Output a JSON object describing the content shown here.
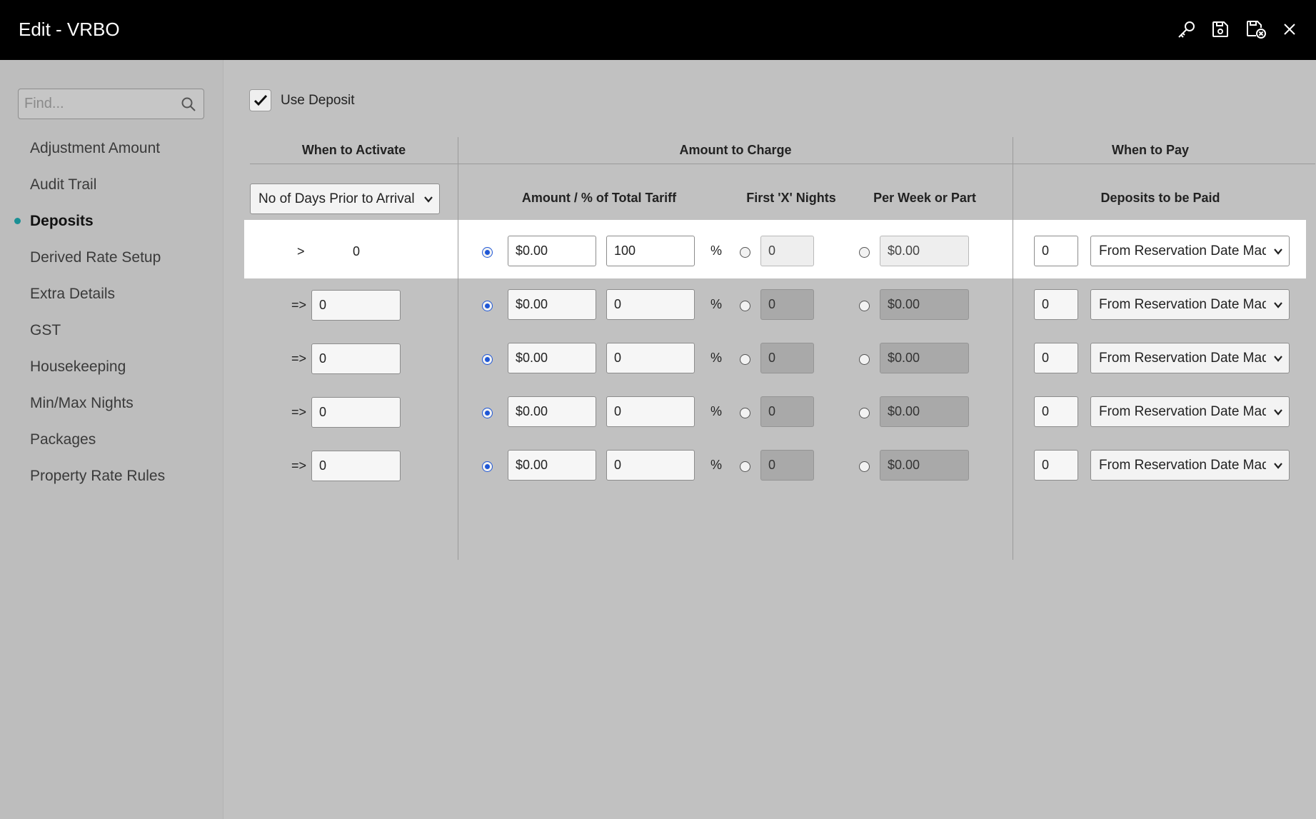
{
  "window": {
    "title": "Edit - VRBO",
    "icons": [
      "key-icon",
      "save-icon",
      "save-and-close-icon",
      "close-icon"
    ]
  },
  "sidebar": {
    "find_placeholder": "Find...",
    "items": [
      {
        "label": "Adjustment Amount",
        "active": false
      },
      {
        "label": "Audit Trail",
        "active": false
      },
      {
        "label": "Deposits",
        "active": true
      },
      {
        "label": "Derived Rate Setup",
        "active": false
      },
      {
        "label": "Extra Details",
        "active": false
      },
      {
        "label": "GST",
        "active": false
      },
      {
        "label": "Housekeeping",
        "active": false
      },
      {
        "label": "Min/Max Nights",
        "active": false
      },
      {
        "label": "Packages",
        "active": false
      },
      {
        "label": "Property Rate Rules",
        "active": false
      }
    ]
  },
  "main": {
    "use_deposit_label": "Use Deposit",
    "use_deposit_checked": true,
    "headers": {
      "when_to_activate": "When to Activate",
      "amount_to_charge": "Amount to Charge",
      "when_to_pay": "When to Pay"
    },
    "subheaders": {
      "activation_select": "No of Days Prior to Arrival",
      "amount_pct": "Amount / % of Total Tariff",
      "first_x_nights": "First 'X' Nights",
      "per_week": "Per Week or Part",
      "deposits_to_be_paid": "Deposits to be Paid"
    },
    "rows": [
      {
        "operator": ">",
        "days": "0",
        "amount": "$0.00",
        "percent": "100",
        "pct_symbol": "%",
        "nights": "0",
        "per_week": "$0.00",
        "pay_count": "0",
        "pay_from": "From Reservation Date Made",
        "highlighted": true
      },
      {
        "operator": "=>",
        "days": "0",
        "amount": "$0.00",
        "percent": "0",
        "pct_symbol": "%",
        "nights": "0",
        "per_week": "$0.00",
        "pay_count": "0",
        "pay_from": "From Reservation Date Made",
        "highlighted": false
      },
      {
        "operator": "=>",
        "days": "0",
        "amount": "$0.00",
        "percent": "0",
        "pct_symbol": "%",
        "nights": "0",
        "per_week": "$0.00",
        "pay_count": "0",
        "pay_from": "From Reservation Date Made",
        "highlighted": false
      },
      {
        "operator": "=>",
        "days": "0",
        "amount": "$0.00",
        "percent": "0",
        "pct_symbol": "%",
        "nights": "0",
        "per_week": "$0.00",
        "pay_count": "0",
        "pay_from": "From Reservation Date Made",
        "highlighted": false
      },
      {
        "operator": "=>",
        "days": "0",
        "amount": "$0.00",
        "percent": "0",
        "pct_symbol": "%",
        "nights": "0",
        "per_week": "$0.00",
        "pay_count": "0",
        "pay_from": "From Reservation Date Made",
        "highlighted": false
      }
    ]
  },
  "colors": {
    "titlebar": "#000000",
    "background": "#c1c1c1",
    "sidebar": "#bdbdbd",
    "active_dot": "#1a8f94",
    "radio_selected": "#1f57d6",
    "highlight_row": "#ffffff",
    "disabled_field": "#a9a9a9"
  }
}
